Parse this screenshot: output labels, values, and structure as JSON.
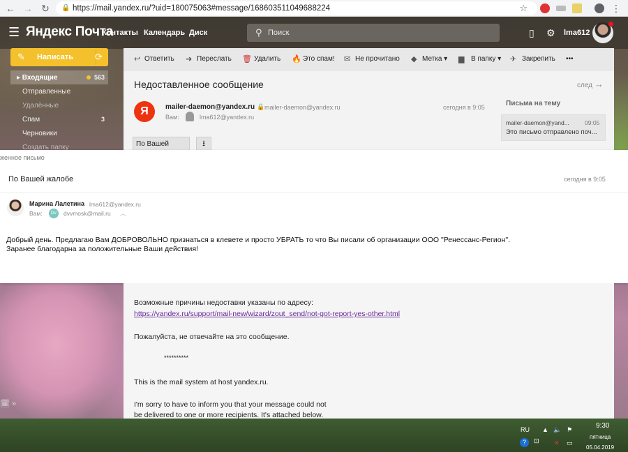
{
  "browser": {
    "url": "https://mail.yandex.ru/?uid=180075063#message/168603511049688224"
  },
  "header": {
    "logo": "Яндекс Почта",
    "nav": [
      "Контакты",
      "Календарь",
      "Диск"
    ],
    "search_placeholder": "Поиск",
    "username": "lma612"
  },
  "sidebar": {
    "compose_label": "Написать",
    "folders": [
      {
        "label": "▸ Входящие",
        "count": "563"
      },
      {
        "label": "Отправленные",
        "count": ""
      },
      {
        "label": "Удалённые",
        "count": ""
      },
      {
        "label": "Спам",
        "count": "3"
      },
      {
        "label": "Черновики",
        "count": ""
      },
      {
        "label": "Создать папку",
        "count": ""
      }
    ]
  },
  "toolbar": {
    "reply": "Ответить",
    "forward": "Переслать",
    "delete": "Удалить",
    "spam": "Это спам!",
    "unread": "Не прочитано",
    "label": "Метка ▾",
    "folder": "В папку ▾",
    "pin": "Закрепить",
    "more": "•••"
  },
  "message": {
    "subject": "Недоставленное сообщение",
    "next": "след",
    "from_name": "mailer-daemon@yandex.ru",
    "from_addr": "mailer-daemon@yandex.ru",
    "date": "сегодня в 9:05",
    "to_label": "Вам:",
    "to_addr": "lma612@yandex.ru",
    "attachment": "По Вашей",
    "avatar_letter": "Я"
  },
  "thread": {
    "title": "Письма на тему",
    "from": "mailer-daemon@yand...",
    "time": "09:05",
    "snippet": "Это письмо отправлено поч..."
  },
  "overlay": {
    "crumb": "женное письмо",
    "subject": "По Вашей жалобе",
    "date": "сегодня в 9:05",
    "from_name": "Марина Лалетина",
    "from_addr": "lma612@yandex.ru",
    "to_label": "Вам:",
    "to_badge": "DV",
    "to_addr": "dvvmosk@mail.ru",
    "line1": "Добрый день. Предлагаю Вам ДОБРОВОЛЬНО признаться в клевете и просто УБРАТЬ то что Вы писали об организации ООО \"Ренессанс-Регион\".",
    "line2": "Заранее благодарна за положительные Ваши действия!"
  },
  "body": {
    "reasons": "Возможные причины недоставки указаны по адресу:",
    "link": "https://yandex.ru/support/mail-new/wizard/zout_send/not-got-report-yes-other.html",
    "noreply": "Пожалуйста, не отвечайте на это сообщение.",
    "stars": "**********",
    "system": "This is the mail system at host yandex.ru.",
    "sorry": "I'm sorry to have to inform you that your message could not",
    "partial": "be delivered to one or more recipients. It's attached below."
  },
  "taskbar": {
    "lang": "RU",
    "time": "9:30",
    "day": "пятница",
    "date": "05.04.2019"
  }
}
